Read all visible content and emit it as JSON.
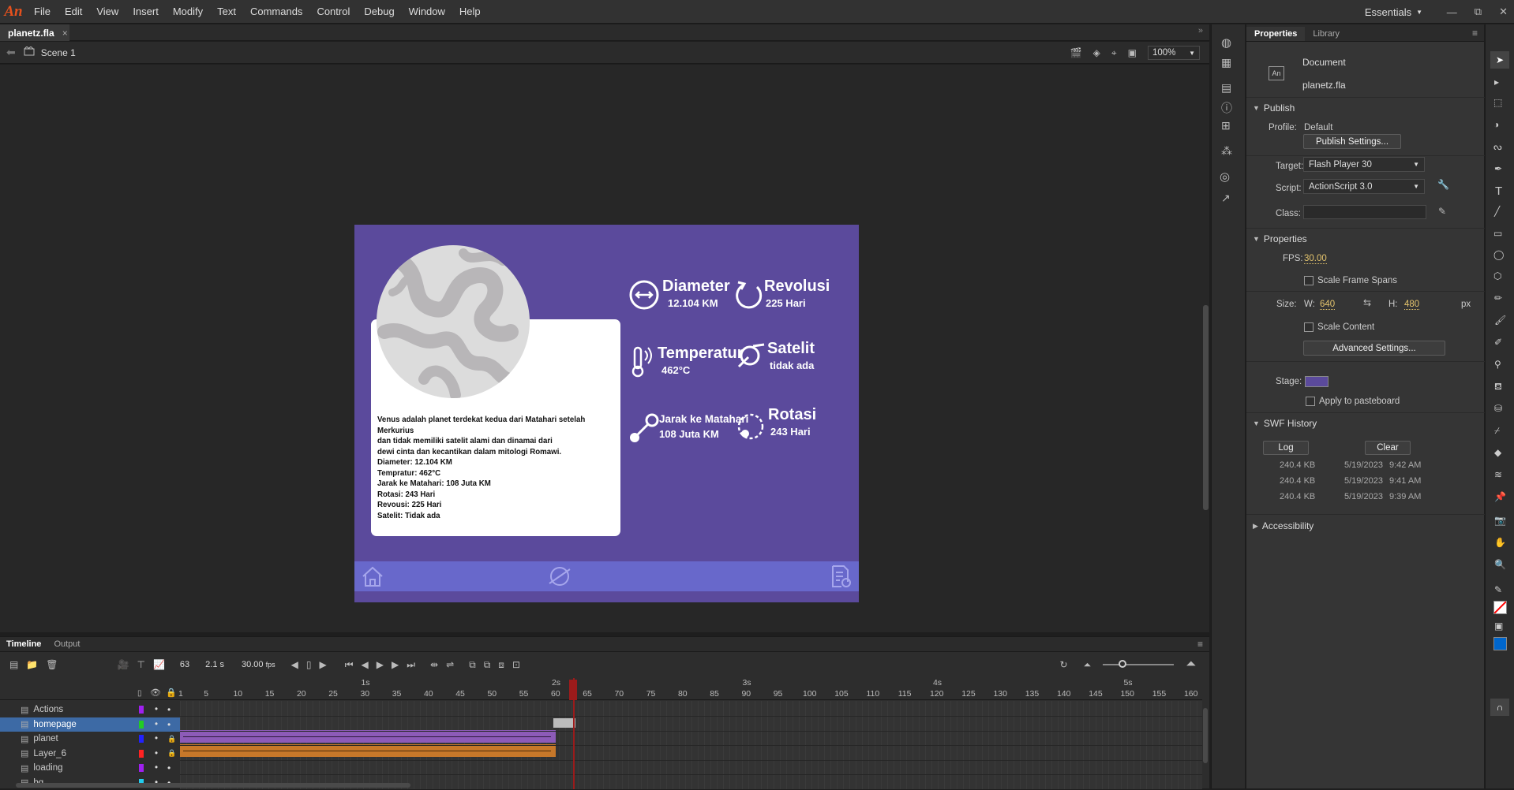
{
  "menubar": {
    "logo": "An",
    "items": [
      "File",
      "Edit",
      "View",
      "Insert",
      "Modify",
      "Text",
      "Commands",
      "Control",
      "Debug",
      "Window",
      "Help"
    ],
    "workspace": "Essentials",
    "window_buttons": [
      "—",
      "⧉",
      "✕"
    ]
  },
  "doc_tab": {
    "label": "planetz.fla",
    "close": "×"
  },
  "scene": {
    "label": "Scene 1",
    "zoom": "100%"
  },
  "stage": {
    "background": "#5b4a9c",
    "description_lines": [
      "Venus adalah planet terdekat kedua dari Matahari setelah Merkurius",
      "dan tidak memiliki satelit alami dan dinamai dari",
      "dewi cinta dan kecantikan dalam mitologi Romawi.",
      "Diameter: 12.104 KM",
      "Tempratur: 462°C",
      "Jarak ke Matahari: 108 Juta KM",
      "Rotasi: 243 Hari",
      "Revousi: 225 Hari",
      "Satelit: Tidak ada"
    ],
    "stats": {
      "diameter": {
        "label": "Diameter",
        "value": "12.104 KM"
      },
      "revolusi": {
        "label": "Revolusi",
        "value": "225 Hari"
      },
      "temperatur": {
        "label": "Temperatur",
        "value": "462°C"
      },
      "satelit": {
        "label": "Satelit",
        "value": "tidak ada"
      },
      "jarak": {
        "label": "Jarak ke Matahari",
        "value": "108 Juta KM"
      },
      "rotasi": {
        "label": "Rotasi",
        "value": "243 Hari"
      }
    }
  },
  "properties": {
    "tabs": [
      "Properties",
      "Library"
    ],
    "doc_type": "Document",
    "doc_icon": "An",
    "filename": "planetz.fla",
    "publish": {
      "header": "Publish",
      "profile_label": "Profile:",
      "profile_value": "Default",
      "publish_settings": "Publish Settings...",
      "target_label": "Target:",
      "target_value": "Flash Player 30",
      "script_label": "Script:",
      "script_value": "ActionScript 3.0",
      "class_label": "Class:"
    },
    "props": {
      "header": "Properties",
      "fps_label": "FPS:",
      "fps_value": "30.00",
      "scale_frame_spans": "Scale Frame Spans",
      "size_label": "Size:",
      "w_label": "W:",
      "w_value": "640",
      "h_label": "H:",
      "h_value": "480",
      "unit": "px",
      "scale_content": "Scale Content",
      "advanced_settings": "Advanced Settings...",
      "stage_label": "Stage:",
      "stage_color": "#5b4a9c",
      "apply_pasteboard": "Apply to pasteboard"
    },
    "swf_history": {
      "header": "SWF History",
      "log": "Log",
      "clear": "Clear",
      "entries": [
        {
          "size": "240.4 KB",
          "date": "5/19/2023",
          "time": "9:42 AM"
        },
        {
          "size": "240.4 KB",
          "date": "5/19/2023",
          "time": "9:41 AM"
        },
        {
          "size": "240.4 KB",
          "date": "5/19/2023",
          "time": "9:39 AM"
        }
      ]
    },
    "accessibility": "Accessibility"
  },
  "timeline": {
    "tabs": [
      "Timeline",
      "Output"
    ],
    "current_frame": "63",
    "time": "2.1 s",
    "fps": "30.00",
    "fps_unit": "fps",
    "ruler_seconds": [
      "1s",
      "2s",
      "3s",
      "4s",
      "5s"
    ],
    "ruler_frames": [
      "1",
      "5",
      "10",
      "15",
      "20",
      "25",
      "30",
      "35",
      "40",
      "45",
      "50",
      "55",
      "60",
      "65",
      "70",
      "75",
      "80",
      "85",
      "90",
      "95",
      "100",
      "105",
      "110",
      "115",
      "120",
      "125",
      "130",
      "135",
      "140",
      "145",
      "150",
      "155",
      "160"
    ],
    "layers": [
      {
        "name": "Actions",
        "color": "#a020f0",
        "selected": false,
        "locked": false
      },
      {
        "name": "homepage",
        "color": "#22cc22",
        "selected": true,
        "locked": false
      },
      {
        "name": "planet",
        "color": "#2222ff",
        "selected": false,
        "locked": true
      },
      {
        "name": "Layer_6",
        "color": "#ff2222",
        "selected": false,
        "locked": true
      },
      {
        "name": "loading",
        "color": "#a020f0",
        "selected": false,
        "locked": false
      },
      {
        "name": "bg",
        "color": "#22ccee",
        "selected": false,
        "locked": false
      }
    ]
  }
}
